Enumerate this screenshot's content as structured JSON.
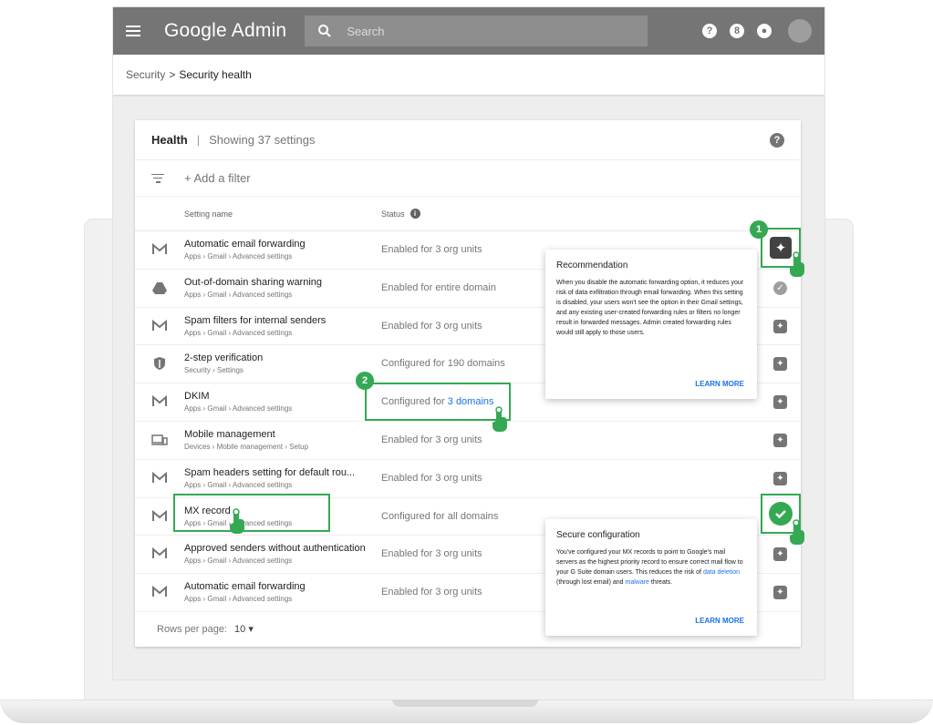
{
  "app": {
    "brand": "Google Admin",
    "search_placeholder": "Search",
    "top_icons": [
      "help-icon",
      "apps-icon",
      "notifications-icon",
      "account-avatar"
    ]
  },
  "breadcrumb": {
    "parent": "Security",
    "separator": ">",
    "current": "Security health"
  },
  "card": {
    "title": "Health",
    "divider": "|",
    "subtitle": "Showing 37 settings",
    "filter_label": "+ Add a filter",
    "col_setting": "Setting name",
    "col_status": "Status"
  },
  "rows": [
    {
      "icon": "gmail-icon",
      "name": "Automatic email forwarding",
      "path": "Apps › Gmail › Advanced settings",
      "status": "Enabled for 3 org units",
      "action": "recommendation-icon"
    },
    {
      "icon": "drive-icon",
      "name": "Out-of-domain sharing warning",
      "path": "Apps › Gmail › Advanced settings",
      "status": "Enabled for entire domain",
      "action": "check-icon"
    },
    {
      "icon": "gmail-icon",
      "name": "Spam filters for internal senders",
      "path": "Apps › Gmail › Advanced settings",
      "status": "Enabled for 3 org units",
      "action": "recommendation-icon"
    },
    {
      "icon": "shield-icon",
      "name": "2-step verification",
      "path": "Security › Settings",
      "status": "Configured for 190 domains",
      "action": "recommendation-icon"
    },
    {
      "icon": "gmail-icon",
      "name": "DKIM",
      "path": "Apps › Gmail › Advanced settings",
      "status_prefix": "Configured for ",
      "status_link": "3 domains",
      "action": "recommendation-icon"
    },
    {
      "icon": "devices-icon",
      "name": "Mobile management",
      "path": "Devices › Mobile management › Setup",
      "status": "Enabled for 3 org units",
      "action": "recommendation-icon"
    },
    {
      "icon": "gmail-icon",
      "name": "Spam headers setting for default rou...",
      "path": "Apps › Gmail › Advanced settings",
      "status": "Enabled for 3 org units",
      "action": "recommendation-icon"
    },
    {
      "icon": "gmail-icon",
      "name": "MX record",
      "path": "Apps › Gmail › Advanced settings",
      "status": "Configured for all domains",
      "action": "check-icon"
    },
    {
      "icon": "gmail-icon",
      "name": "Approved senders without authentication",
      "path": "Apps › Gmail › Advanced settings",
      "status": "Enabled for 3 org units",
      "action": "recommendation-icon"
    },
    {
      "icon": "gmail-icon",
      "name": "Automatic email forwarding",
      "path": "Apps › Gmail › Advanced settings",
      "status": "Enabled for 3 org units",
      "action": "recommendation-icon"
    }
  ],
  "footer": {
    "rows_label": "Rows per page:",
    "rows_value": "10",
    "rows_caret": "▾"
  },
  "popover_recommendation": {
    "title": "Recommendation",
    "body": "When you disable the automatic forwarding option, it reduces your risk of data exfiltration through email forwarding. When this setting is disabled, your users won't see the option in their Gmail settings, and any existing user-created forwarding rules or filters no longer result in forwarded messages. Admin created forwarding rules would still apply to those users.",
    "action": "LEARN MORE"
  },
  "popover_secure": {
    "title": "Secure configuration",
    "body_1": "You've configured your MX records to point to Google's mail servers as the highest priority record to ensure correct mail flow to your G Suite domain users. This reduces the risk of ",
    "link_1": "data deletion",
    "body_2": " (through lost email) and ",
    "link_2": "malware",
    "body_3": " threats.",
    "action": "LEARN MORE"
  },
  "callouts": {
    "badge_1": "1",
    "badge_2": "2"
  },
  "colors": {
    "topbar": "#757575",
    "highlight": "#34a853",
    "link": "#1a73e8"
  }
}
